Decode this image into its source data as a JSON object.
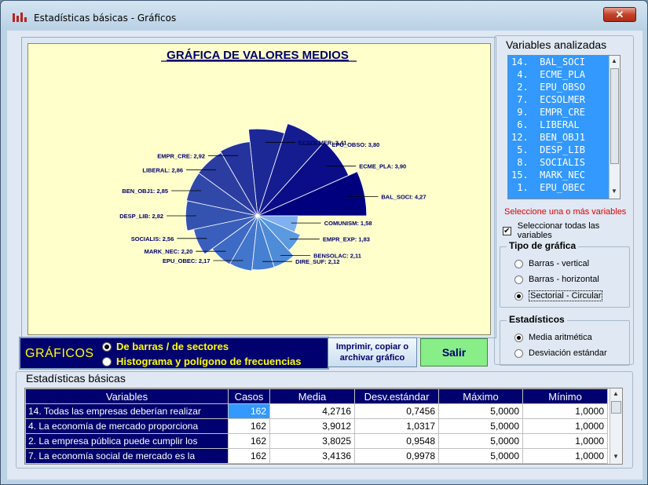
{
  "window": {
    "title": "Estadísticas básicas - Gráficos",
    "close_label": "✕"
  },
  "chart_data": {
    "type": "pie",
    "title": "GRÁFICA DE VALORES MEDIOS",
    "categories": [
      "BAL_SOCI",
      "ECME_PLA",
      "EPU_OBSO",
      "ECSOLMER",
      "EMPR_CRE",
      "LIBERAL",
      "BEN_OBJ1",
      "DESP_LIB",
      "SOCIALIS",
      "MARK_NEC",
      "EPU_OBEC",
      "DIRE_SUF",
      "BENSOLAC",
      "EMPR_EXP",
      "COMUNISM"
    ],
    "values": [
      4.27,
      3.9,
      3.8,
      3.41,
      2.92,
      2.86,
      2.85,
      2.82,
      2.56,
      2.2,
      2.17,
      2.12,
      2.11,
      1.83,
      1.58
    ],
    "value_labels": [
      "4,27",
      "3,90",
      "3,80",
      "3,41",
      "2,92",
      "2,86",
      "2,85",
      "2,82",
      "2,56",
      "2,20",
      "2,17",
      "2,12",
      "2,11",
      "1,83",
      "1,58"
    ],
    "colors": [
      "#00007f",
      "#0b0d88",
      "#151c90",
      "#1c2896",
      "#25339c",
      "#2c3da2",
      "#3048a8",
      "#3453b0",
      "#3a5ebb",
      "#3d6ac4",
      "#4275cc",
      "#4680d2",
      "#4f8cd8",
      "#5b99e0",
      "#7fb0ef"
    ]
  },
  "graficos": {
    "label": "GRÁFICOS",
    "options": [
      "De barras / de sectores",
      "Histograma y polígono de frecuencias"
    ]
  },
  "buttons": {
    "print": "Imprimir, copiar o archivar gráfico",
    "salir": "Salir"
  },
  "variables": {
    "title": "Variables analizadas",
    "items": [
      "14.  BAL_SOCI",
      " 4.  ECME_PLA",
      " 2.  EPU_OBSO",
      " 7.  ECSOLMER",
      " 9.  EMPR_CRE",
      " 6.  LIBERAL",
      "12.  BEN_OBJ1",
      " 5.  DESP_LIB",
      " 8.  SOCIALIS",
      "15.  MARK_NEC",
      " 1.  EPU_OBEC"
    ],
    "hint": "Seleccione una o más variables",
    "select_all": "Seleccionar todas las variables"
  },
  "tipo": {
    "title": "Tipo de gráfica",
    "options": [
      "Barras - vertical",
      "Barras - horizontal",
      "Sectorial - Circular"
    ]
  },
  "estadisticos": {
    "title": "Estadísticos",
    "options": [
      "Media aritmética",
      "Desviación estándar"
    ]
  },
  "stats": {
    "title": "Estadísticas básicas",
    "headers": [
      "Variables",
      "Casos",
      "Media",
      "Desv.estándar",
      "Máximo",
      "Mínimo"
    ],
    "rows": [
      [
        "14. Todas las empresas deberían realizar",
        "162",
        "4,2716",
        "0,7456",
        "5,0000",
        "1,0000"
      ],
      [
        "4. La economía de mercado proporciona",
        "162",
        "3,9012",
        "1,0317",
        "5,0000",
        "1,0000"
      ],
      [
        "2. La empresa pública puede cumplir los",
        "162",
        "3,8025",
        "0,9548",
        "5,0000",
        "1,0000"
      ],
      [
        "7. La economía social de mercado es la",
        "162",
        "3,4136",
        "0,9978",
        "5,0000",
        "1,0000"
      ]
    ]
  }
}
